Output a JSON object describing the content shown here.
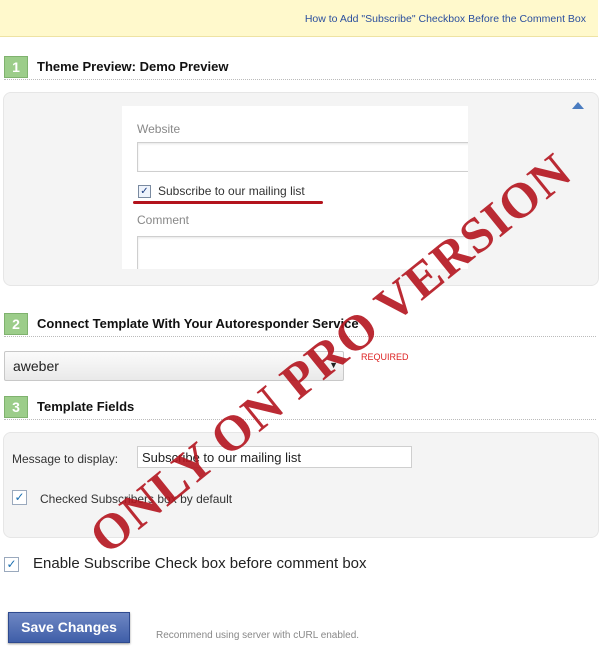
{
  "topbar": {
    "help_link": "How to Add \"Subscribe\" Checkbox Before the Comment Box"
  },
  "sections": [
    {
      "number": "1",
      "title": "Theme Preview: Demo Preview"
    },
    {
      "number": "2",
      "title": "Connect Template With Your Autoresponder Service"
    },
    {
      "number": "3",
      "title": "Template Fields"
    }
  ],
  "preview": {
    "website_label": "Website",
    "subscribe_label": "Subscribe to our mailing list",
    "subscribe_checked": true,
    "comment_label": "Comment"
  },
  "autoresponder": {
    "selected": "aweber",
    "required_label": "REQUIRED"
  },
  "fields": {
    "message_label": "Message to display:",
    "message_value": "Subscribe to our mailing list",
    "checked_default_label": "Checked Subscribers box by default",
    "checked_default": true
  },
  "enable": {
    "label": "Enable Subscribe Check box before comment box",
    "checked": true
  },
  "footer": {
    "save_label": "Save Changes",
    "note": "Recommend using server with cURL enabled."
  },
  "watermark": "ONLY ON PRO VERSION",
  "colors": {
    "accent": "#9ccd8a",
    "button": "#3f5ea8",
    "watermark": "#b4141e",
    "required": "#dd2222"
  }
}
